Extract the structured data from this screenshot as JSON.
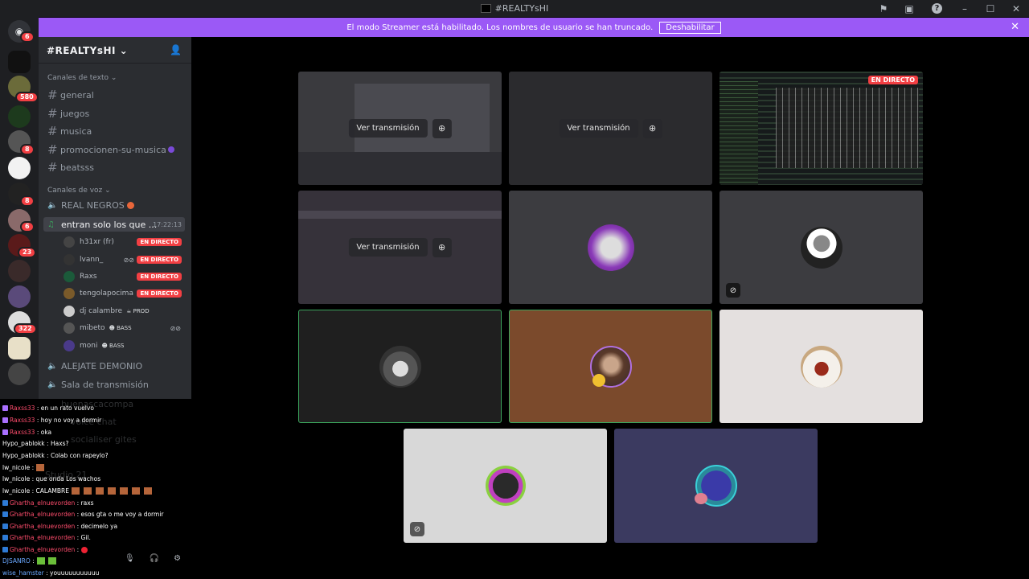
{
  "window": {
    "title": "#REALTYsHI"
  },
  "banner": {
    "message": "El modo Streamer está habilitado. Los nombres de usuario se han truncado.",
    "button_label": "Deshabilitar"
  },
  "guilds": {
    "badges": [
      "6",
      "580",
      "8",
      "8",
      "6",
      "23",
      "322"
    ]
  },
  "server": {
    "name": "#REALTYsHI"
  },
  "text_category": "Canales de texto",
  "text_channels": [
    "general",
    "juegos",
    "musica",
    "promocionen-su-musica",
    "beatsss"
  ],
  "voice_category": "Canales de voz",
  "voice_channels": {
    "real_negros": "REAL NEGROS",
    "active": {
      "name": "entran solo los que ...",
      "time": "17:22:13"
    },
    "alejate": "ALEJATE DEMONIO",
    "sala": "Sala de transmisión"
  },
  "voice_users": [
    {
      "name": "h31xr (fr)",
      "live": "EN DIRECTO",
      "role": ""
    },
    {
      "name": "lvann_",
      "live": "EN DIRECTO",
      "role": ""
    },
    {
      "name": "Raxs",
      "live": "EN DIRECTO",
      "role": ""
    },
    {
      "name": "tengolapocima",
      "live": "EN DIRECTO",
      "role": ""
    },
    {
      "name": "dj calambre",
      "live": "",
      "role": "PROD"
    },
    {
      "name": "mibeto",
      "live": "",
      "role": "BASS"
    },
    {
      "name": "moni",
      "live": "",
      "role": "BASS"
    }
  ],
  "ghost_channels": [
    "buenascacompa",
    "voice chat",
    "socialiser gites",
    "Studio 21"
  ],
  "chat": [
    {
      "user": "Raxss33",
      "text": ": en un rato vuelvo",
      "color": "#ff4d6d"
    },
    {
      "user": "Raxss33",
      "text": ": hoy no voy a dormir",
      "color": "#ff4d6d"
    },
    {
      "user": "Raxss33",
      "text": ": oka",
      "color": "#ff4d6d"
    },
    {
      "user": "Hypo_pablokk",
      "text": ": Haxs?",
      "color": "#ffffff"
    },
    {
      "user": "Hypo_pablokk",
      "text": ": Colab con rapeylo?",
      "color": "#ffffff"
    },
    {
      "user": "lw_nicole",
      "text": ":",
      "color": "#ffffff"
    },
    {
      "user": "lw_nicole",
      "text": ": que onda Los wachos",
      "color": "#ffffff"
    },
    {
      "user": "lw_nicole",
      "text": ": CALAMBRE",
      "color": "#ffffff"
    },
    {
      "user": "Ghartha_elnuevorden",
      "text": ": raxs",
      "color": "#ff4d6d"
    },
    {
      "user": "Ghartha_elnuevorden",
      "text": ": esos gta o me voy a dormir",
      "color": "#ff4d6d"
    },
    {
      "user": "Ghartha_elnuevorden",
      "text": ": decimelo ya",
      "color": "#ff4d6d"
    },
    {
      "user": "Ghartha_elnuevorden",
      "text": ": Gil.",
      "color": "#ff4d6d"
    },
    {
      "user": "Ghartha_elnuevorden",
      "text": ":",
      "color": "#ff4d6d"
    },
    {
      "user": "DJSANRO",
      "text": ":",
      "color": "#6aa8ff"
    },
    {
      "user": "wise_hamster",
      "text": ": youuuuuuuuuuu",
      "color": "#6aa8ff"
    }
  ],
  "stage": {
    "watch_label": "Ver transmisión",
    "live_label": "EN DIRECTO"
  },
  "colors": {
    "accent": "#9b59f6",
    "live": "#f23f43",
    "speaking": "#3ba55c"
  }
}
